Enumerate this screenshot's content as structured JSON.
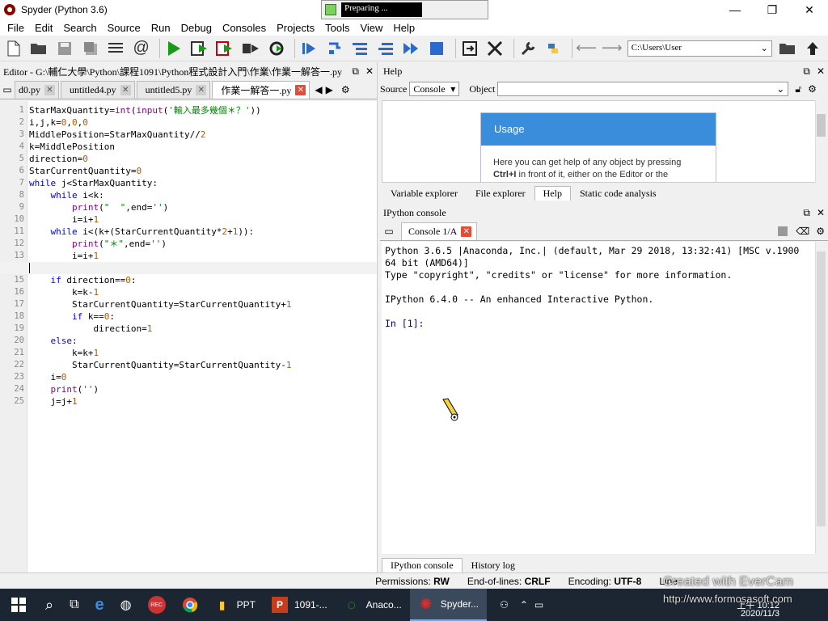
{
  "window": {
    "title": "Spyder (Python 3.6)",
    "minimize": "—",
    "maximize": "❐",
    "close": "✕"
  },
  "preparing": {
    "label": "Preparing ..."
  },
  "menu": [
    "File",
    "Edit",
    "Search",
    "Source",
    "Run",
    "Debug",
    "Consoles",
    "Projects",
    "Tools",
    "View",
    "Help"
  ],
  "toolbar": {
    "path": "C:\\Users\\User"
  },
  "editor": {
    "header": "Editor - G:\\輔仁大學\\Python\\課程1091\\Python程式設計入門\\作業\\作業一解答一.py",
    "tabs": [
      {
        "label": "d0.py",
        "active": false
      },
      {
        "label": "untitled4.py",
        "active": false
      },
      {
        "label": "untitled5.py",
        "active": false
      },
      {
        "label": "作業一解答一.py",
        "active": true
      }
    ],
    "current_line": 14,
    "lines": [
      "StarMaxQuantity=int(input('輸入最多幾個＊？'))",
      "i,j,k=0,0,0",
      "MiddlePosition=StarMaxQuantity//2",
      "k=MiddlePosition",
      "direction=0",
      "StarCurrentQuantity=0",
      "while j<StarMaxQuantity:",
      "    while i<k:",
      "        print(\"  \",end='')",
      "        i=i+1",
      "    while i<(k+(StarCurrentQuantity*2+1)):",
      "        print(\"＊\",end='')",
      "        i=i+1",
      "",
      "    if direction==0:",
      "        k=k-1",
      "        StarCurrentQuantity=StarCurrentQuantity+1",
      "        if k==0:",
      "            direction=1",
      "    else:",
      "        k=k+1",
      "        StarCurrentQuantity=StarCurrentQuantity-1",
      "    i=0",
      "    print('')",
      "    j=j+1"
    ]
  },
  "help": {
    "header": "Help",
    "source_label": "Source",
    "source_value": "Console",
    "object_label": "Object",
    "usage_title": "Usage",
    "usage_text_1": "Here you can get help of any object by pressing",
    "usage_text_2_bold": "Ctrl+I",
    "usage_text_2": " in front of it, either on the Editor or the",
    "tabs": [
      "Variable explorer",
      "File explorer",
      "Help",
      "Static code analysis"
    ],
    "active_tab": "Help"
  },
  "ipython": {
    "header": "IPython console",
    "tab_label": "Console 1/A",
    "output": [
      "Python 3.6.5 |Anaconda, Inc.| (default, Mar 29 2018, 13:32:41) [MSC v.1900",
      "64 bit (AMD64)]",
      "Type \"copyright\", \"credits\" or \"license\" for more information.",
      "",
      "IPython 6.4.0 -- An enhanced Interactive Python.",
      "",
      "In [1]:"
    ],
    "bottom_tabs": [
      "IPython console",
      "History log"
    ],
    "active_bottom_tab": "IPython console"
  },
  "status": {
    "permissions_label": "Permissions:",
    "permissions_value": "RW",
    "eol_label": "End-of-lines:",
    "eol_value": "CRLF",
    "encoding_label": "Encoding:",
    "encoding_value": "UTF-8",
    "line_label": "Line"
  },
  "taskbar": {
    "items": [
      {
        "label": "PPT",
        "icon": "folder-icon",
        "active": false
      },
      {
        "label": "1091-...",
        "icon": "powerpoint-icon",
        "active": false
      },
      {
        "label": "Anaco...",
        "icon": "anaconda-icon",
        "active": false
      },
      {
        "label": "Spyder...",
        "icon": "spyder-icon",
        "active": true
      }
    ],
    "clock_time": "上午 10:12",
    "clock_date": "2020/11/3"
  },
  "watermark": {
    "line1": "Created with EverCam",
    "line2": "http://www.formosasoft.com"
  },
  "colors": {
    "keyword": "#0000ff",
    "builtin": "#900090",
    "string": "#008000",
    "number": "#b05800",
    "usage_header": "#3a8ddb",
    "close_tab": "#e04e39"
  }
}
